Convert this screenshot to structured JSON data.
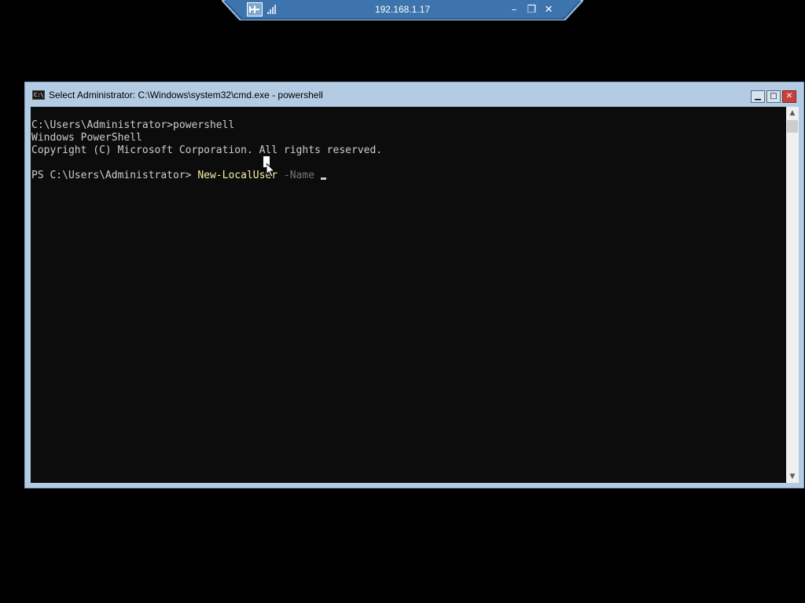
{
  "remote_bar": {
    "title": "192.168.1.17",
    "pin_icon": "pin-icon",
    "signal_icon": "connection-signal-icon",
    "minimize_glyph": "–",
    "restore_glyph": "❐",
    "close_glyph": "✕"
  },
  "window": {
    "title": "Select Administrator: C:\\Windows\\system32\\cmd.exe - powershell",
    "icon": "cmd-icon",
    "icon_text": "C:\\",
    "minimize_glyph": "▁",
    "maximize_glyph": "□",
    "close_glyph": "✕"
  },
  "console": {
    "line1": "C:\\Users\\Administrator>powershell",
    "line2": "Windows PowerShell",
    "line3": "Copyright (C) Microsoft Corporation. All rights reserved.",
    "prompt": "PS C:\\Users\\Administrator> ",
    "command": "New-LocalUser",
    "parameter": " -Name ",
    "colors": {
      "background": "#0c0c0c",
      "text": "#cccccc",
      "command": "#f9f1a5",
      "parameter": "#767676"
    }
  },
  "scrollbar": {
    "up_glyph": "▲",
    "down_glyph": "▼"
  }
}
